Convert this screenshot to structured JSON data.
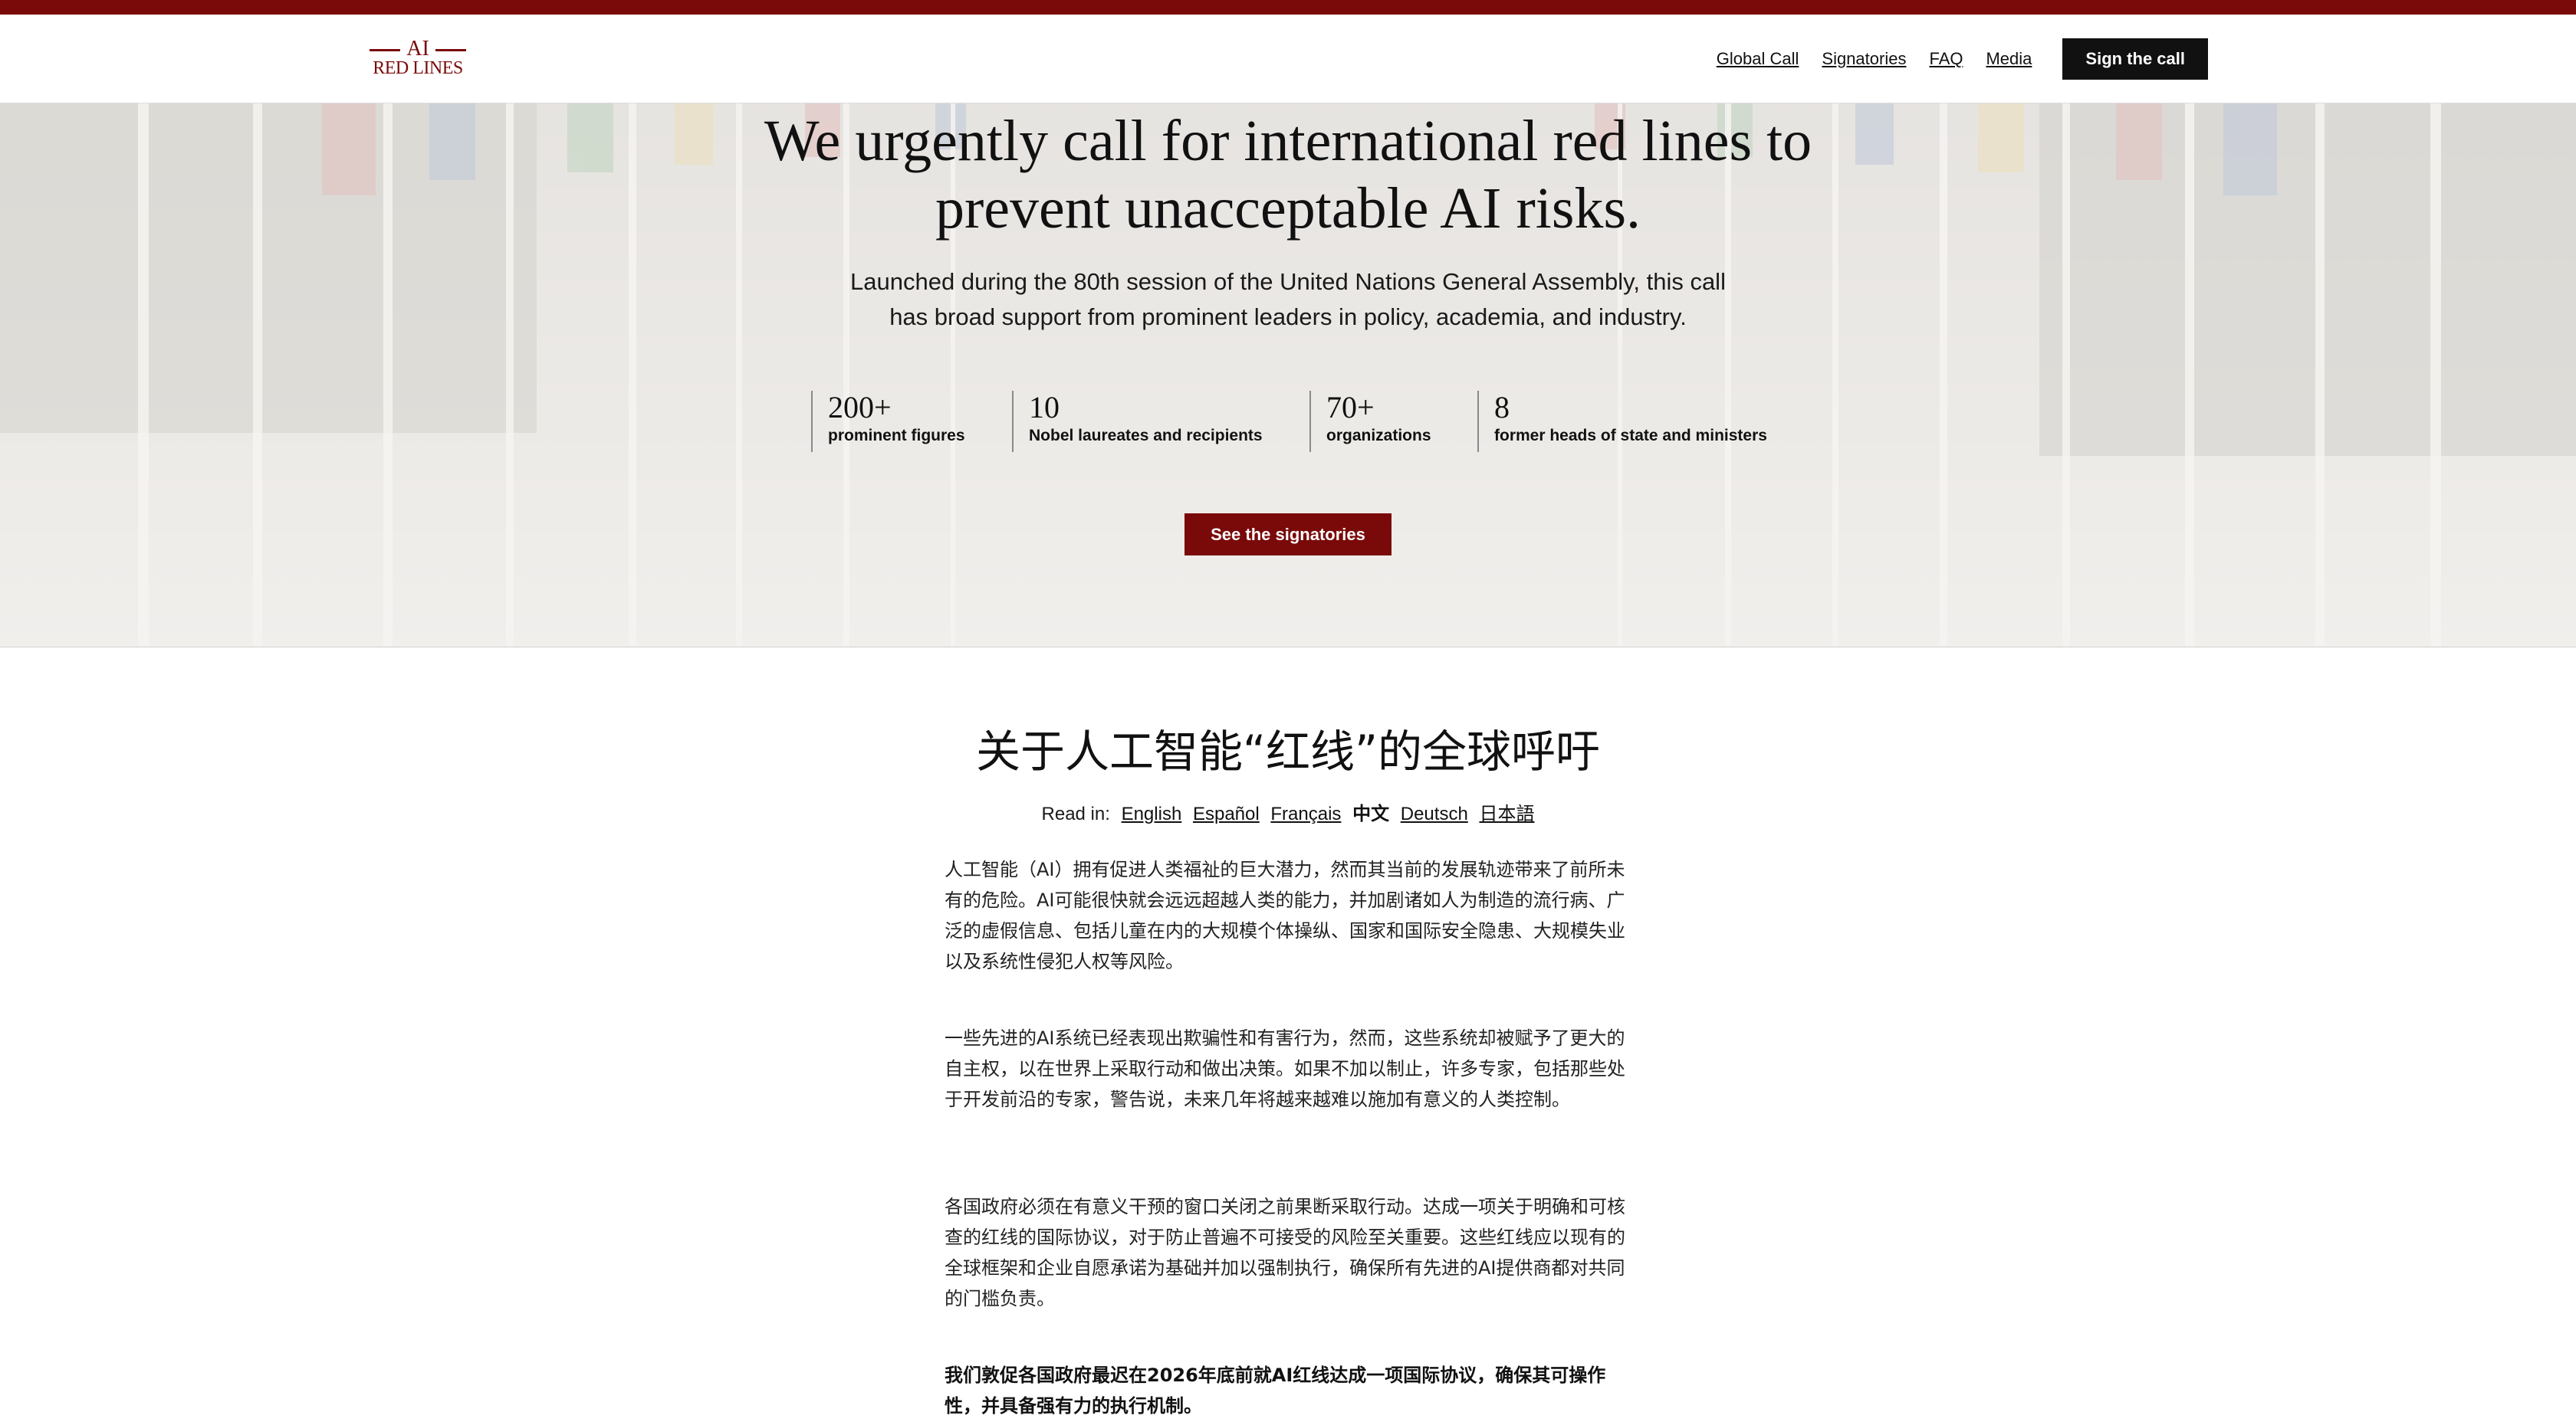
{
  "header": {
    "logo_top": "AI",
    "logo_bottom": "RED LINES",
    "nav": [
      "Global Call",
      "Signatories",
      "FAQ",
      "Media"
    ],
    "cta": "Sign the call"
  },
  "hero": {
    "title": "We urgently call for international red lines to prevent unacceptable AI risks.",
    "subtitle": "Launched during the 80th session of the United Nations General Assembly, this call has broad support from prominent leaders in policy, academia, and industry.",
    "stats": [
      {
        "value": "200+",
        "label": "prominent figures"
      },
      {
        "value": "10",
        "label": "Nobel laureates and recipients"
      },
      {
        "value": "70+",
        "label": "organizations"
      },
      {
        "value": "8",
        "label": "former heads of state and ministers"
      }
    ],
    "button": "See the signatories"
  },
  "content": {
    "title": "关于人工智能“红线”的全球呼吁",
    "read_in_label": "Read in:",
    "languages": [
      "English",
      "Español",
      "Français",
      "中文",
      "Deutsch",
      "日本語"
    ],
    "active_language": "中文",
    "paragraphs": [
      "人工智能（AI）拥有促进人类福祉的巨大潜力，然而其当前的发展轨迹带来了前所未有的危险。AI可能很快就会远远超越人类的能力，并加剧诸如人为制造的流行病、广泛的虚假信息、包括儿童在内的大规模个体操纵、国家和国际安全隐患、大规模失业以及系统性侵犯人权等风险。",
      "一些先进的AI系统已经表现出欺骗性和有害行为，然而，这些系统却被赋予了更大的自主权，以在世界上采取行动和做出决策。如果不加以制止，许多专家，包括那些处于开发前沿的专家，警告说，未来几年将越来越难以施加有意义的人类控制。",
      "各国政府必须在有意义干预的窗口关闭之前果断采取行动。达成一项关于明确和可核查的红线的国际协议，对于防止普遍不可接受的风险至关重要。这些红线应以现有的全球框架和企业自愿承诺为基础并加以强制执行，确保所有先进的AI提供商都对共同的门槛负责。",
      "我们敦促各国政府最迟在2026年底前就AI红线达成一项国际协议，确保其可操作性，并具备强有力的执行机制。"
    ]
  },
  "colors": {
    "accent": "#7a0a0a",
    "cta_dark": "#111111"
  }
}
